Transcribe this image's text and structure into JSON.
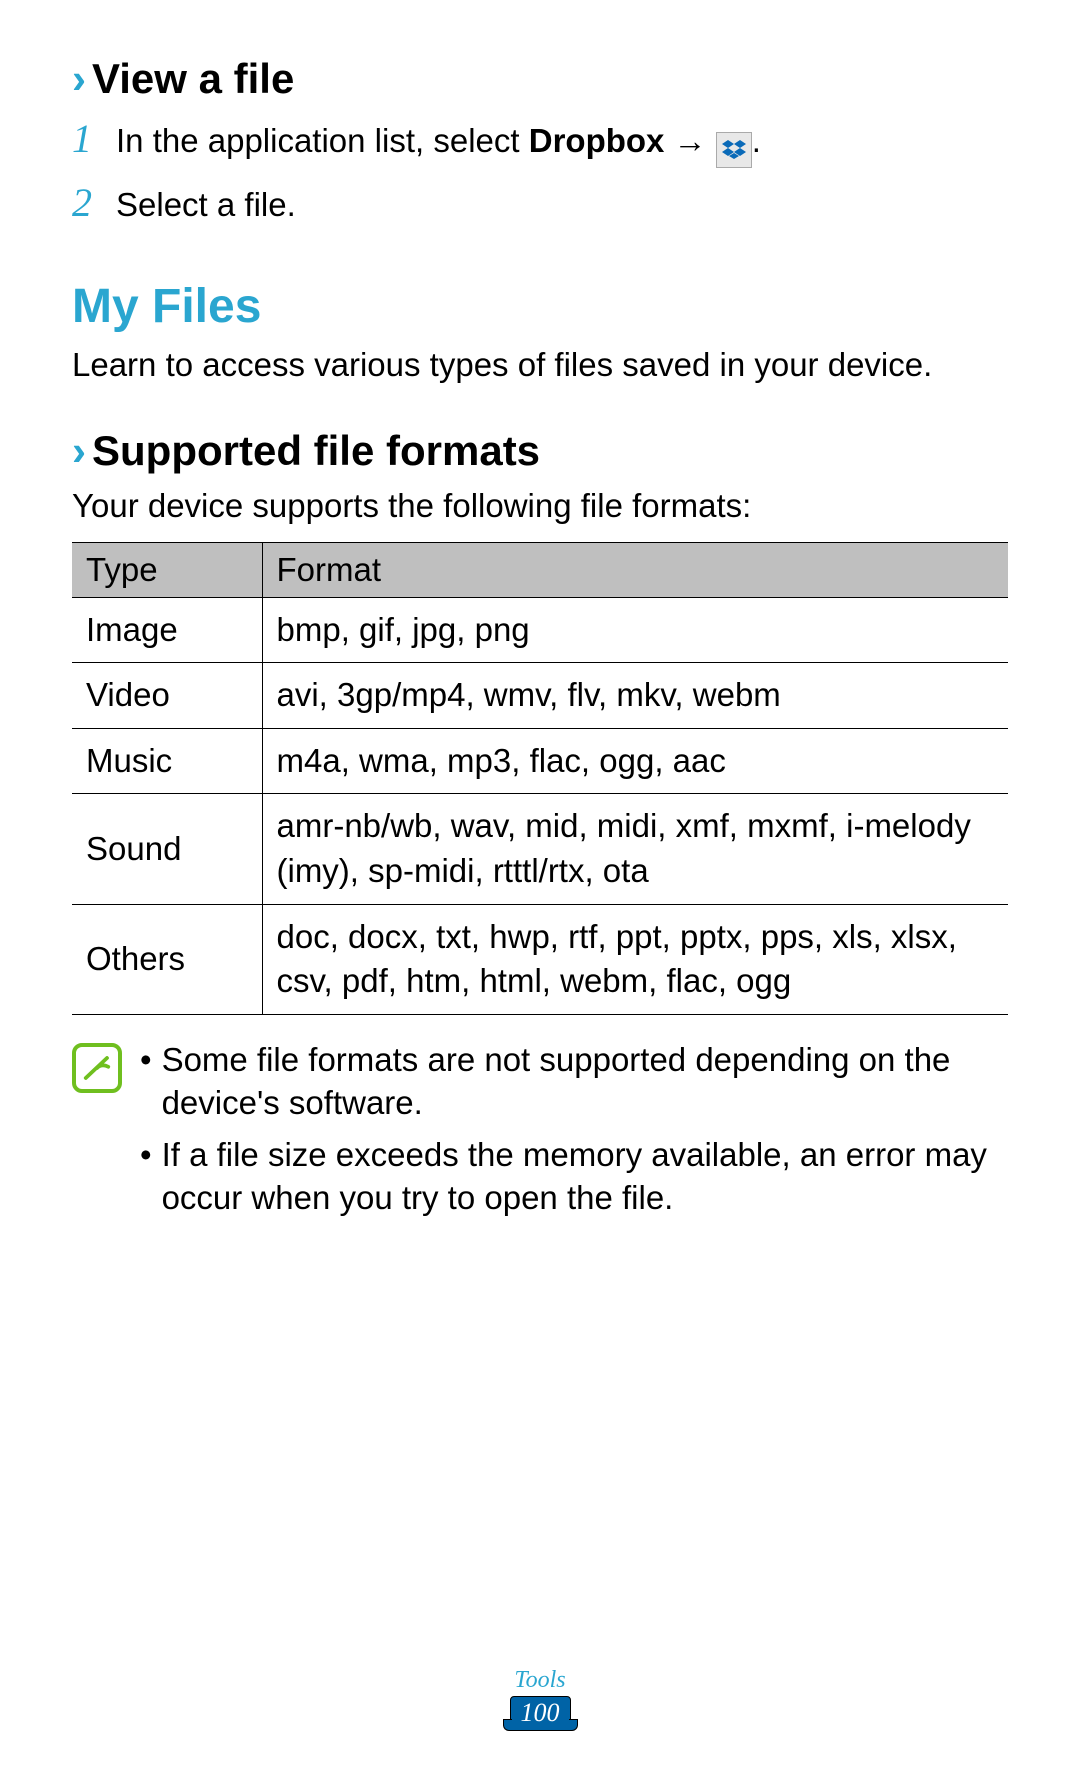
{
  "section1": {
    "title": "View a file",
    "steps": [
      {
        "pre": "In the application list, select ",
        "bold": "Dropbox",
        "post": " → ",
        "tail": "."
      },
      {
        "text": "Select a file."
      }
    ]
  },
  "section2": {
    "title": "My Files",
    "intro": "Learn to access various types of files saved in your device."
  },
  "section3": {
    "title": "Supported file formats",
    "intro": "Your device supports the following file formats:",
    "table": {
      "headers": [
        "Type",
        "Format"
      ],
      "rows": [
        [
          "Image",
          "bmp, gif, jpg, png"
        ],
        [
          "Video",
          "avi, 3gp/mp4, wmv, flv, mkv, webm"
        ],
        [
          "Music",
          "m4a, wma, mp3, flac, ogg, aac"
        ],
        [
          "Sound",
          "amr-nb/wb, wav, mid, midi, xmf, mxmf, i-melody (imy), sp-midi, rtttl/rtx, ota"
        ],
        [
          "Others",
          "doc, docx, txt, hwp, rtf, ppt, pptx, pps, xls, xlsx, csv, pdf, htm, html, webm, flac, ogg"
        ]
      ]
    },
    "notes": [
      "Some file formats are not supported depending on the device's software.",
      "If a file size exceeds the memory available, an error may occur when you try to open the file."
    ]
  },
  "footer": {
    "section": "Tools",
    "page": "100"
  }
}
